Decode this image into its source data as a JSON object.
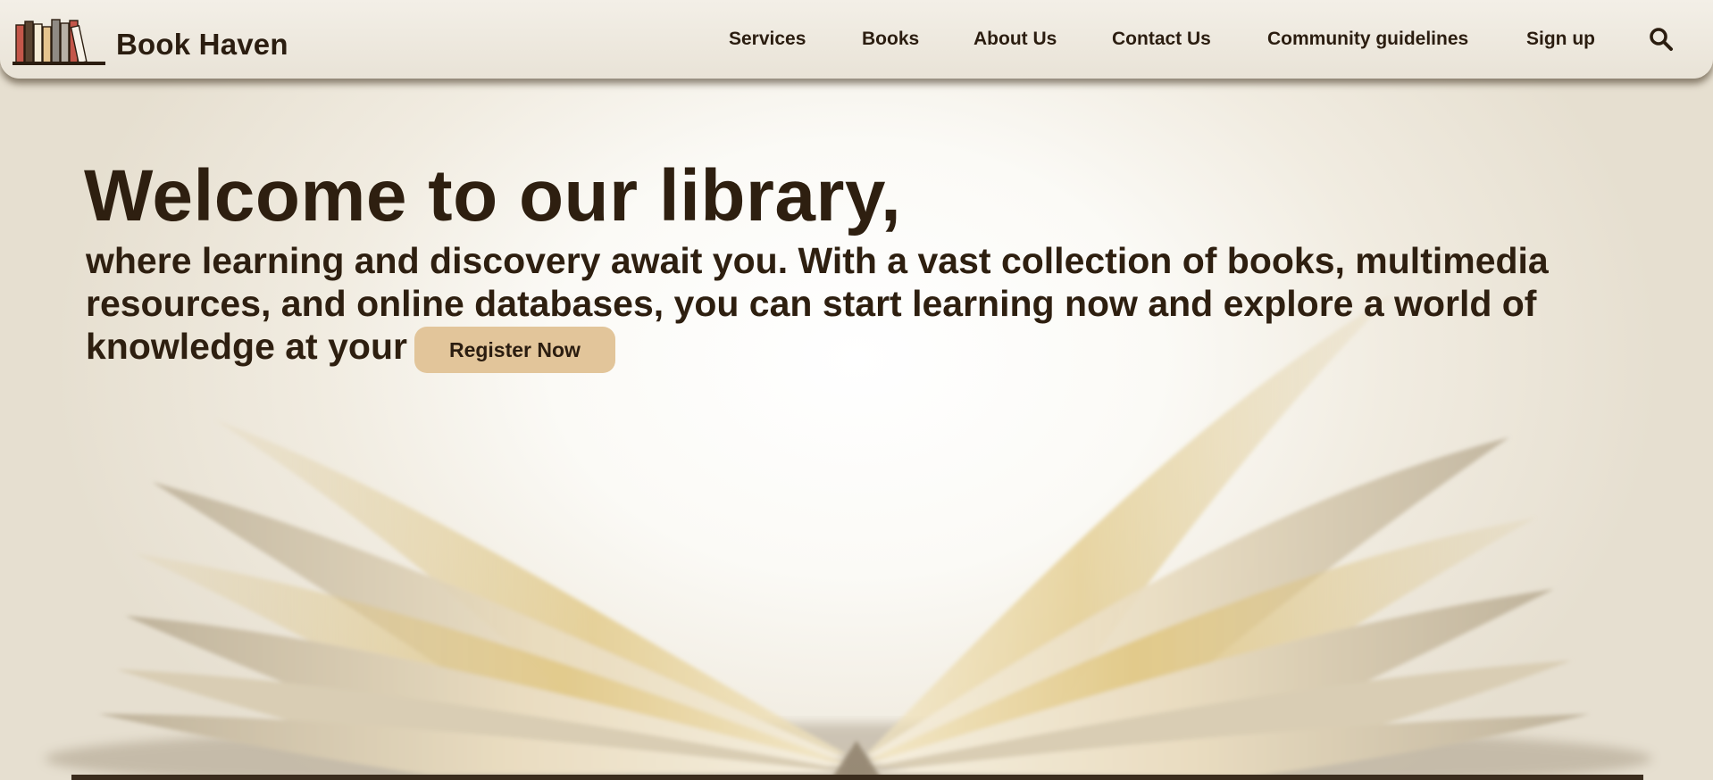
{
  "header": {
    "brand": "Book Haven",
    "nav": [
      {
        "label": "Services"
      },
      {
        "label": "Books"
      },
      {
        "label": "About Us"
      },
      {
        "label": "Contact Us"
      },
      {
        "label": "Community guidelines"
      },
      {
        "label": "Sign up"
      }
    ],
    "search_icon": "search-icon",
    "logo_icon": "bookshelf-icon"
  },
  "hero": {
    "title": "Welcome to our library,",
    "body": "where learning and discovery await you. With a vast collection of books, multimedia resources, and online databases, you can start learning now and explore a world of knowledge at your",
    "cta_label": "Register Now"
  },
  "colors": {
    "text": "#2e1f10",
    "cta_background": "#e2c59a",
    "navbar_background": "#efeae0"
  }
}
